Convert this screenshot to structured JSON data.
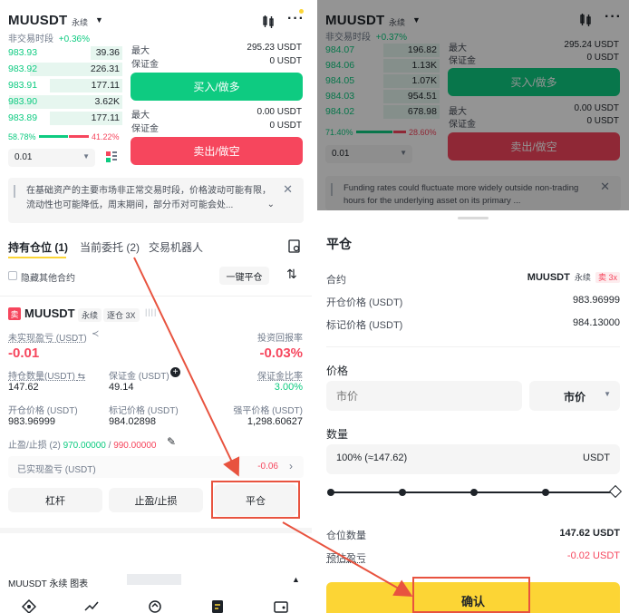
{
  "left": {
    "header": {
      "symbol": "MUUSDT",
      "contract": "永续",
      "session": "非交易时段",
      "change": "+0.36%"
    },
    "orderbook": [
      {
        "price": "983.93",
        "qty": "39.36",
        "depth": 0.28
      },
      {
        "price": "983.92",
        "qty": "226.31",
        "depth": 0.82
      },
      {
        "price": "983.91",
        "qty": "177.11",
        "depth": 0.64
      },
      {
        "price": "983.90",
        "qty": "3.62K",
        "depth": 1.0
      },
      {
        "price": "983.89",
        "qty": "177.11",
        "depth": 0.64
      }
    ],
    "ratio": {
      "buy": "58.78%",
      "sell": "41.22%"
    },
    "precision": "0.01",
    "buy_block": {
      "max_label": "最大",
      "max_value": "295.23 USDT",
      "margin_label": "保证金",
      "margin_value": "0 USDT",
      "button": "买入/做多"
    },
    "sell_block": {
      "max_label": "最大",
      "max_value": "0.00 USDT",
      "margin_label": "保证金",
      "margin_value": "0 USDT",
      "button": "卖出/做空"
    },
    "notice": "在基础资产的主要市场非正常交易时段，价格波动可能有限，流动性也可能降低，周末期间，部分币对可能会处...",
    "tabs": [
      "持有仓位 (1)",
      "当前委托 (2)",
      "交易机器人"
    ],
    "hide_others": "隐藏其他合约",
    "close_all": "一键平仓",
    "position": {
      "side_badge": "卖",
      "symbol": "MUUSDT",
      "contract": "永续",
      "mode": "逐仓 3X",
      "unrealized_label": "未实现盈亏 (USDT)",
      "unrealized_value": "-0.01",
      "roi_label": "投资回报率",
      "roi_value": "-0.03%",
      "size_label": "持仓数量(USDT)",
      "size_value": "147.62",
      "margin_label": "保证金 (USDT)",
      "margin_value": "49.14",
      "margin_ratio_label": "保证金比率",
      "margin_ratio_value": "3.00%",
      "entry_label": "开仓价格 (USDT)",
      "entry_value": "983.96999",
      "mark_label": "标记价格 (USDT)",
      "mark_value": "984.02898",
      "liq_label": "强平价格 (USDT)",
      "liq_value": "1,298.60627",
      "tpsl_label": "止盈/止损 (2)",
      "tp_value": "970.00000",
      "sl_value": "990.00000",
      "realized_label": "已实现盈亏 (USDT)",
      "realized_value": "-0.06"
    },
    "actions": [
      "杠杆",
      "止盈/止损",
      "平仓"
    ],
    "chart_bar": "MUUSDT 永续 图表"
  },
  "right": {
    "header": {
      "symbol": "MUUSDT",
      "contract": "永续",
      "session": "非交易时段",
      "change": "+0.37%"
    },
    "orderbook": [
      {
        "price": "984.07",
        "qty": "196.82"
      },
      {
        "price": "984.06",
        "qty": "1.13K"
      },
      {
        "price": "984.05",
        "qty": "1.07K"
      },
      {
        "price": "984.03",
        "qty": "954.51"
      },
      {
        "price": "984.02",
        "qty": "678.98"
      }
    ],
    "ratio": {
      "buy": "71.40%",
      "sell": "28.60%"
    },
    "precision": "0.01",
    "buy_block": {
      "max_label": "最大",
      "max_value": "295.24 USDT",
      "margin_label": "保证金",
      "margin_value": "0 USDT",
      "button": "买入/做多"
    },
    "sell_block": {
      "max_label": "最大",
      "max_value": "0.00 USDT",
      "margin_label": "保证金",
      "margin_value": "0 USDT",
      "button": "卖出/做空"
    },
    "notice": "Funding rates could fluctuate more widely outside non-trading hours for the underlying asset on its primary ...",
    "sheet": {
      "title": "平仓",
      "contract_label": "合约",
      "contract_symbol": "MUUSDT",
      "contract_type": "永续",
      "contract_badge": "卖 3x",
      "entry_label": "开仓价格 (USDT)",
      "entry_value": "983.96999",
      "mark_label": "标记价格 (USDT)",
      "mark_value": "984.13000",
      "price_label": "价格",
      "price_placeholder": "市价",
      "price_type": "市价",
      "qty_label": "数量",
      "qty_value": "100% (≈147.62)",
      "qty_unit": "USDT",
      "slider_percent": 100,
      "position_qty_label": "仓位数量",
      "position_qty_value": "147.62 USDT",
      "est_pnl_label": "预估盈亏",
      "est_pnl_value": "-0.02 USDT",
      "confirm": "确认"
    }
  },
  "colors": {
    "green": "#0ecb81",
    "red": "#f6465d",
    "accent": "#fcd535",
    "highlight": "#e8533f"
  }
}
